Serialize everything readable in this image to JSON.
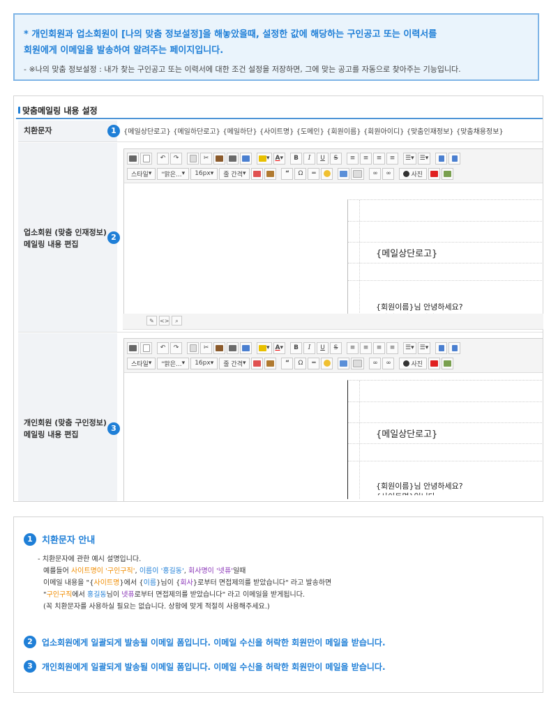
{
  "notice": {
    "line1": "* 개인회원과 업소회원이 [나의 맞춤 정보설정]을 해놓았을때, 설정한 값에 해당하는 구인공고 또는 이력서를",
    "line2": "회원에게 이메일을 발송하여 알려주는 페이지입니다.",
    "line3": "- ※나의 맞춤 정보설정 : 내가 찾는 구인공고 또는 이력서에 대한 조건 설정을 저장하면, 그에 맞는 공고를 자동으로 찾아주는 기능입니다."
  },
  "section": {
    "title": "맞춤메일링 내용 설정",
    "rows": [
      {
        "num": "1",
        "label": "치환문자",
        "codes": "{메일상단로고} {메일하단로고} {메일하단} {사이트명} {도메인} {회원이름} {회원아이디} {맞춤인재정보} {맞춤채용정보}"
      },
      {
        "num": "2",
        "label_line1": "업소회원 (맞춤 인재정보)",
        "label_line2": "메일링 내용 편집"
      },
      {
        "num": "3",
        "label_line1": "개인회원 (맞춤 구인정보)",
        "label_line2": "메일링 내용 편집"
      }
    ]
  },
  "toolbar": {
    "style": "스타일",
    "font": "\"맑은...",
    "size": "16px",
    "spacing": "줄 간격",
    "bold": "B",
    "italic": "I",
    "underline": "U",
    "strike": "S",
    "quote": "“",
    "omega": "Ω",
    "photo": "사진"
  },
  "editor_content": {
    "logo": "{메일상단로고}",
    "greeting": "{회원이름}님 안녕하세요?",
    "cut_line": "{사이트명}입니다."
  },
  "guide": {
    "items": [
      {
        "num": "1",
        "title": "치환문자 안내"
      },
      {
        "num": "2",
        "title": "업소회원에게 일괄되게 발송될 이메일 폼입니다. 이메일 수신을 허락한 회원만이 메일을 받습니다."
      },
      {
        "num": "3",
        "title": "개인회원에게 일괄되게 발송될 이메일 폼입니다. 이메일 수신을 허락한 회원만이 메일을 받습니다."
      }
    ],
    "desc1": "- 치환문자에 관한 예시 설명입니다.",
    "ex_prefix": "예를들어 ",
    "ex_site": "사이트명이 '구인구직'",
    "ex_sep1": ", ",
    "ex_name": "이름이 '홍길동'",
    "ex_sep2": ", ",
    "ex_company": "회사명이 '넷퓨'",
    "ex_suffix": "일때",
    "mail_prefix": "이메일 내용을 \"{",
    "mail_site": "사이트명",
    "mail_mid1": "}에서 {",
    "mail_name": "이름",
    "mail_mid2": "}님이 {",
    "mail_company": "회사",
    "mail_suffix": "}로부터 면접제의를 받았습니다\" 라고 발송하면",
    "res_prefix": "\"",
    "res_site": "구인구직",
    "res_mid1": "에서 ",
    "res_name": "홍길동",
    "res_mid2": "님이 ",
    "res_company": "넷퓨",
    "res_suffix": "로부터 면접제의를 받았습니다\" 라고 이메일을 받게됩니다.",
    "note": "(꼭 치환문자를 사용하실 필요는 없습니다. 상황에 맞게 적절히 사용해주세요.)"
  },
  "colors": {
    "accent": "#1f7fd7",
    "orange": "#f08c00",
    "purple": "#8a35b8"
  }
}
